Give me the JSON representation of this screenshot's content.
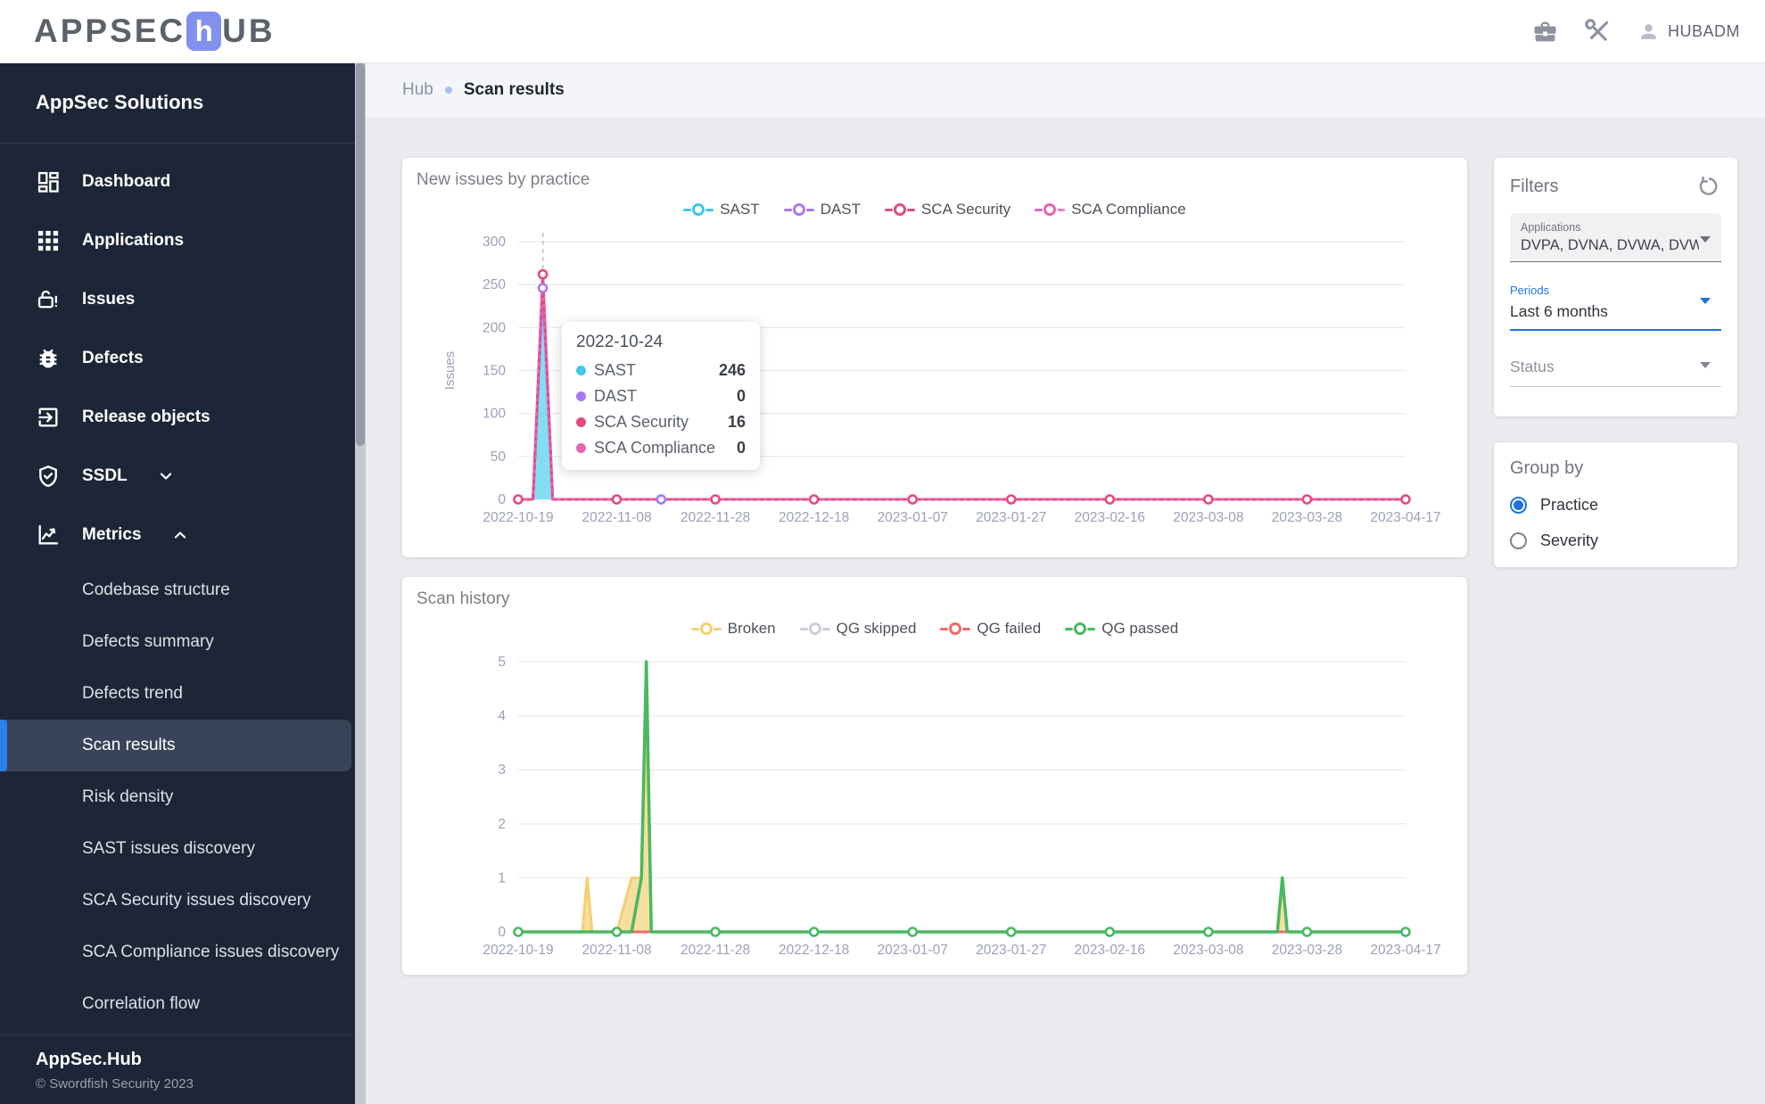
{
  "header": {
    "logo": {
      "prefix": "APPSEC",
      "tile": "h",
      "suffix": "UB"
    },
    "user": "HUBADM",
    "colors": {
      "logo_tile": "#8091ee",
      "icon": "#8d92a1"
    }
  },
  "sidebar": {
    "section_title": "AppSec Solutions",
    "items": [
      {
        "label": "Dashboard",
        "icon": "dashboard"
      },
      {
        "label": "Applications",
        "icon": "apps"
      },
      {
        "label": "Issues",
        "icon": "lock"
      },
      {
        "label": "Defects",
        "icon": "bug"
      },
      {
        "label": "Release objects",
        "icon": "exit"
      },
      {
        "label": "SSDL",
        "icon": "shield",
        "chevron": "down"
      },
      {
        "label": "Metrics",
        "icon": "chart",
        "chevron": "up",
        "children": [
          "Codebase structure",
          "Defects summary",
          "Defects trend",
          "Scan results",
          "Risk density",
          "SAST issues discovery",
          "SCA Security issues discovery",
          "SCA Compliance issues discovery",
          "Correlation flow"
        ],
        "active_child": "Scan results"
      }
    ],
    "footer": {
      "title": "AppSec.Hub",
      "copyright": "© Swordfish Security 2023"
    },
    "colors": {
      "bg": "#1d2636",
      "active_bg": "#3a4458",
      "active_bar": "#2e7fe9"
    }
  },
  "breadcrumb": {
    "root": "Hub",
    "current": "Scan results"
  },
  "tooltip": {
    "date": "2022-10-24",
    "rows": [
      {
        "name": "SAST",
        "value": "246",
        "color": "#3fc8e4"
      },
      {
        "name": "DAST",
        "value": "0",
        "color": "#a877f7"
      },
      {
        "name": "SCA Security",
        "value": "16",
        "color": "#e34b80"
      },
      {
        "name": "SCA Compliance",
        "value": "0",
        "color": "#e765b2"
      }
    ]
  },
  "filters": {
    "title": "Filters",
    "applications": {
      "label": "Applications",
      "value": "DVPA, DVNA, DVWA, DVWA..."
    },
    "periods": {
      "label": "Periods",
      "value": "Last 6 months"
    },
    "status": {
      "label": "Status"
    },
    "accent": "#1f71e0"
  },
  "group_by": {
    "title": "Group by",
    "options": [
      {
        "label": "Practice",
        "selected": true
      },
      {
        "label": "Severity",
        "selected": false
      }
    ]
  },
  "chart_data": [
    {
      "type": "area",
      "title": "New issues by practice",
      "ylabel": "Issues",
      "ylim": [
        0,
        300
      ],
      "yticks": [
        0,
        50,
        100,
        150,
        200,
        250,
        300
      ],
      "xmax": 180,
      "xtick_days": [
        0,
        20,
        40,
        60,
        80,
        100,
        120,
        140,
        160,
        180
      ],
      "xtick_labels": [
        "2022-10-19",
        "2022-11-08",
        "2022-11-28",
        "2022-12-18",
        "2023-01-07",
        "2023-01-27",
        "2023-02-16",
        "2023-03-08",
        "2023-03-28",
        "2023-04-17"
      ],
      "stacked": true,
      "grid": true,
      "legend_position": "top",
      "hover_day": 5,
      "days": [
        0,
        3,
        5,
        7,
        20,
        29,
        33,
        40,
        60,
        80,
        100,
        120,
        140,
        160,
        180
      ],
      "series": [
        {
          "name": "SAST",
          "color": "#3fc8e4",
          "fill": true,
          "fill_color": "#6fd8ee",
          "fill_opacity": 0.85,
          "values": [
            0,
            0,
            246,
            0,
            0,
            0,
            0,
            0,
            0,
            0,
            0,
            0,
            0,
            0,
            0
          ],
          "marker_days": []
        },
        {
          "name": "DAST",
          "color": "#a877f7",
          "values": [
            0,
            0,
            0,
            0,
            0,
            0,
            0,
            0,
            0,
            0,
            0,
            0,
            0,
            0,
            0
          ],
          "marker_days": [
            5,
            29
          ]
        },
        {
          "name": "SCA Security",
          "color": "#e34b80",
          "values": [
            0,
            0,
            16,
            0,
            0,
            0,
            0,
            0,
            0,
            0,
            0,
            0,
            0,
            0,
            0
          ],
          "marker_days": [
            5,
            0,
            20,
            40,
            60,
            80,
            100,
            120,
            140,
            160,
            180
          ]
        },
        {
          "name": "SCA Compliance",
          "color": "#e765b2",
          "dashed": true,
          "values": [
            0,
            0,
            0,
            0,
            0,
            0,
            0,
            0,
            0,
            0,
            0,
            0,
            0,
            0,
            0
          ],
          "marker_days": []
        }
      ]
    },
    {
      "type": "area",
      "title": "Scan history",
      "ylabel": "",
      "ylim": [
        0,
        5
      ],
      "yticks": [
        0,
        1,
        2,
        3,
        4,
        5
      ],
      "xmax": 180,
      "xtick_days": [
        0,
        20,
        40,
        60,
        80,
        100,
        120,
        140,
        160,
        180
      ],
      "xtick_labels": [
        "2022-10-19",
        "2022-11-08",
        "2022-11-28",
        "2022-12-18",
        "2023-01-07",
        "2023-01-27",
        "2023-02-16",
        "2023-03-08",
        "2023-03-28",
        "2023-04-17"
      ],
      "stacked": false,
      "grid": true,
      "legend_position": "top",
      "days": [
        0,
        13,
        14,
        15,
        20,
        23,
        25,
        26,
        27,
        40,
        60,
        80,
        100,
        120,
        140,
        154,
        155,
        156,
        160,
        180
      ],
      "series": [
        {
          "name": "Broken",
          "color": "#f3cf77",
          "fill": true,
          "fill_color": "#f6dc96",
          "fill_opacity": 0.9,
          "values": [
            0,
            0,
            1,
            0,
            0,
            1,
            1,
            4,
            0,
            0,
            0,
            0,
            0,
            0,
            0,
            0,
            1,
            0,
            0,
            0
          ],
          "marker_days": []
        },
        {
          "name": "QG skipped",
          "color": "#c9ced8",
          "values": [
            0,
            0,
            0,
            0,
            0,
            0,
            0,
            0,
            0,
            0,
            0,
            0,
            0,
            0,
            0,
            0,
            0,
            0,
            0,
            0
          ],
          "marker_days": []
        },
        {
          "name": "QG failed",
          "color": "#ee6b6b",
          "values": [
            0,
            0,
            0,
            0,
            0,
            0,
            0,
            0,
            0,
            0,
            0,
            0,
            0,
            0,
            0,
            0,
            0,
            0,
            0,
            0
          ],
          "marker_days": []
        },
        {
          "name": "QG passed",
          "color": "#4ab861",
          "width": 3.5,
          "values": [
            0,
            0,
            0,
            0,
            0,
            0,
            1,
            5,
            0,
            0,
            0,
            0,
            0,
            0,
            0,
            0,
            1,
            0,
            0,
            0
          ],
          "marker_days": [
            0,
            20,
            40,
            60,
            80,
            100,
            120,
            140,
            160,
            180
          ]
        }
      ]
    }
  ]
}
